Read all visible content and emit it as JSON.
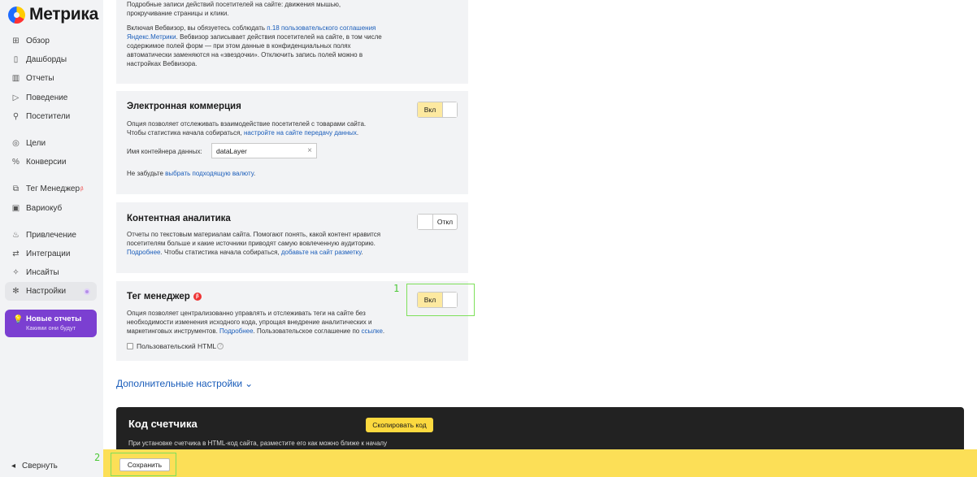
{
  "brand": {
    "name": "Метрика"
  },
  "sidebar": {
    "items": [
      {
        "label": "Обзор",
        "icon": "grid-icon"
      },
      {
        "label": "Дашборды",
        "icon": "dashboard-icon"
      },
      {
        "label": "Отчеты",
        "icon": "bar-chart-icon"
      },
      {
        "label": "Поведение",
        "icon": "play-icon"
      },
      {
        "label": "Посетители",
        "icon": "person-icon"
      },
      {
        "label": "Цели",
        "icon": "target-icon"
      },
      {
        "label": "Конверсии",
        "icon": "percent-icon"
      },
      {
        "label": "Тег Менеджер",
        "icon": "tag-icon",
        "sup": "β"
      },
      {
        "label": "Вариокуб",
        "icon": "cube-icon"
      },
      {
        "label": "Привлечение",
        "icon": "flame-icon"
      },
      {
        "label": "Интеграции",
        "icon": "link-icon"
      },
      {
        "label": "Инсайты",
        "icon": "bulb-icon"
      },
      {
        "label": "Настройки",
        "icon": "gear-icon"
      }
    ],
    "promo": {
      "title": "Новые отчеты",
      "subtitle": "Какими они будут"
    },
    "collapse_label": "Свернуть"
  },
  "webvisor_card": {
    "line1": "Подробные записи действий посетителей на сайте: движения мышью,",
    "line2": "прокручивание страницы и клики.",
    "p2_a": "Включая Вебвизор, вы обязуетесь соблюдать ",
    "p2_link1": "п.18 пользовательского соглашения",
    "p2_link2": "Яндекс.Метрики",
    "p2_b": ". Вебвизор записывает действия посетителей на сайте, в том числе",
    "p2_c": "содержимое полей форм — при этом данные в конфиденциальных полях",
    "p2_d": "автоматически заменяются на «звездочки». Отключить запись полей можно в",
    "p2_e": "настройках Вебвизора."
  },
  "ecommerce": {
    "title": "Электронная коммерция",
    "toggle_label": "Вкл",
    "line1": "Опция позволяет отслеживать взаимодействие посетителей с товарами сайта.",
    "line2_a": "Чтобы статистика начала собираться, ",
    "line2_link": "настройте на сайте передачу данных",
    "line2_b": ".",
    "container_label": "Имя контейнера данных:",
    "container_value": "dataLayer",
    "note_a": "Не забудьте ",
    "note_link": "выбрать подходящую валюту",
    "note_b": "."
  },
  "content_analytics": {
    "title": "Контентная аналитика",
    "toggle_label": "Откл",
    "line1": "Отчеты по текстовым материалам сайта. Помогают понять, какой контент нравится",
    "line2": "посетителям больше и какие источники приводят самую вовлеченную аудиторию.",
    "line3_link1": "Подробнее",
    "line3_a": ". Чтобы статистика начала собираться, ",
    "line3_link2": "добавьте на сайт разметку",
    "line3_b": "."
  },
  "tag_manager": {
    "title": "Тег менеджер",
    "badge": "β",
    "toggle_label": "Вкл",
    "line1": "Опция позволяет централизованно управлять и отслеживать теги на сайте без",
    "line2": "необходимости изменения исходного кода, упрощая внедрение аналитических и",
    "line3_a": "маркетинговых инструментов. ",
    "line3_link1": "Подробнее",
    "line3_b": ". Пользовательское соглашение по ",
    "line3_link2": "ссылке",
    "line3_c": ".",
    "checkbox_label": "Пользовательский HTML"
  },
  "more_settings": "Дополнительные настройки",
  "code_section": {
    "title": "Код счетчика",
    "copy_button": "Скопировать код",
    "text": "При установке счетчика в HTML-код сайта, разместите его как можно ближе к началу"
  },
  "save_button": "Сохранить",
  "annotations": {
    "one": "1",
    "two": "2"
  },
  "colors": {
    "accent_yellow": "#fcdf57",
    "toggle_on": "#fde9a0",
    "link": "#1a5dba",
    "promo": "#7b3fd1",
    "annotation": "#4cc837"
  }
}
